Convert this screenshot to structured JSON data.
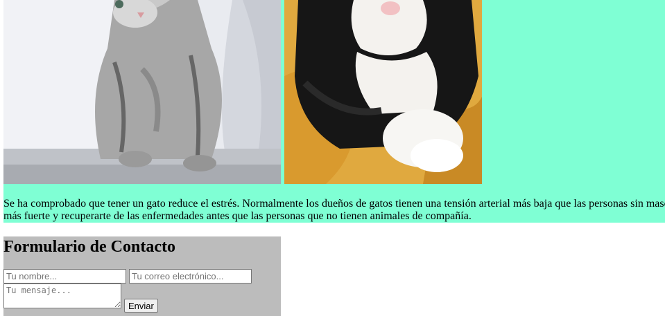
{
  "gallery": {
    "images": [
      {
        "icon": "gray-kitten-photo"
      },
      {
        "icon": "black-and-white-cat-photo"
      }
    ],
    "background_color": "#7fffd4"
  },
  "intro": {
    "line1": "Se ha comprobado que tener un gato reduce el estrés. Normalmente los dueños de gatos tienen una tensión arterial más baja que las personas sin mascota,",
    "line2": "más fuerte y recuperarte de las enfermedades antes que las personas que no tienen animales de compañía."
  },
  "contact_form": {
    "title": "Formulario de Contacto",
    "name_placeholder": "Tu nombre...",
    "email_placeholder": "Tu correo electrónico...",
    "message_placeholder": "Tu mensaje...",
    "submit_label": "Enviar",
    "background_color": "#bcbcbc"
  }
}
